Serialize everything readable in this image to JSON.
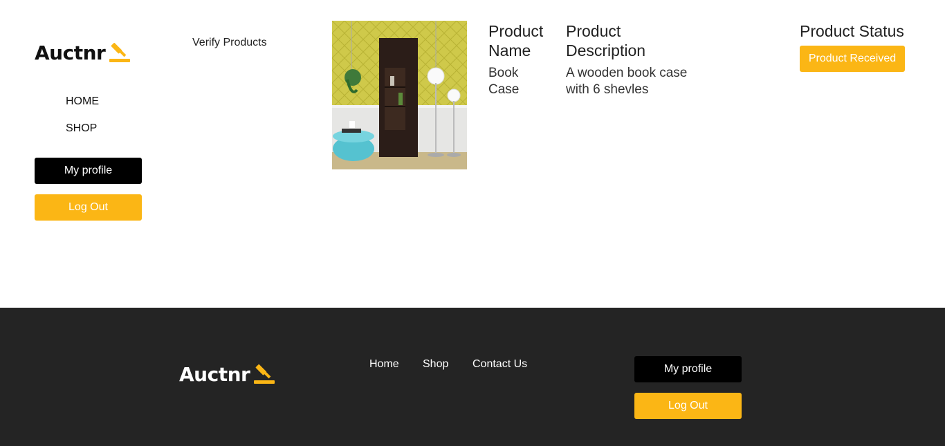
{
  "brand": {
    "name": "Auctnr",
    "accent": "#fbb615",
    "icon": "gavel-icon"
  },
  "sidebar": {
    "nav": [
      {
        "label": "HOME"
      },
      {
        "label": "SHOP"
      }
    ],
    "profile_label": "My profile",
    "logout_label": "Log Out"
  },
  "page": {
    "heading": "Verify Products"
  },
  "product": {
    "name_header": "Product Name",
    "description_header": "Product Description",
    "status_header": "Product Status",
    "name": "Book Case",
    "description": "A wooden book case with 6 shevles",
    "status": "Product Received"
  },
  "footer": {
    "links": [
      {
        "label": "Home"
      },
      {
        "label": "Shop"
      },
      {
        "label": "Contact Us"
      }
    ],
    "profile_label": "My profile",
    "logout_label": "Log Out"
  }
}
